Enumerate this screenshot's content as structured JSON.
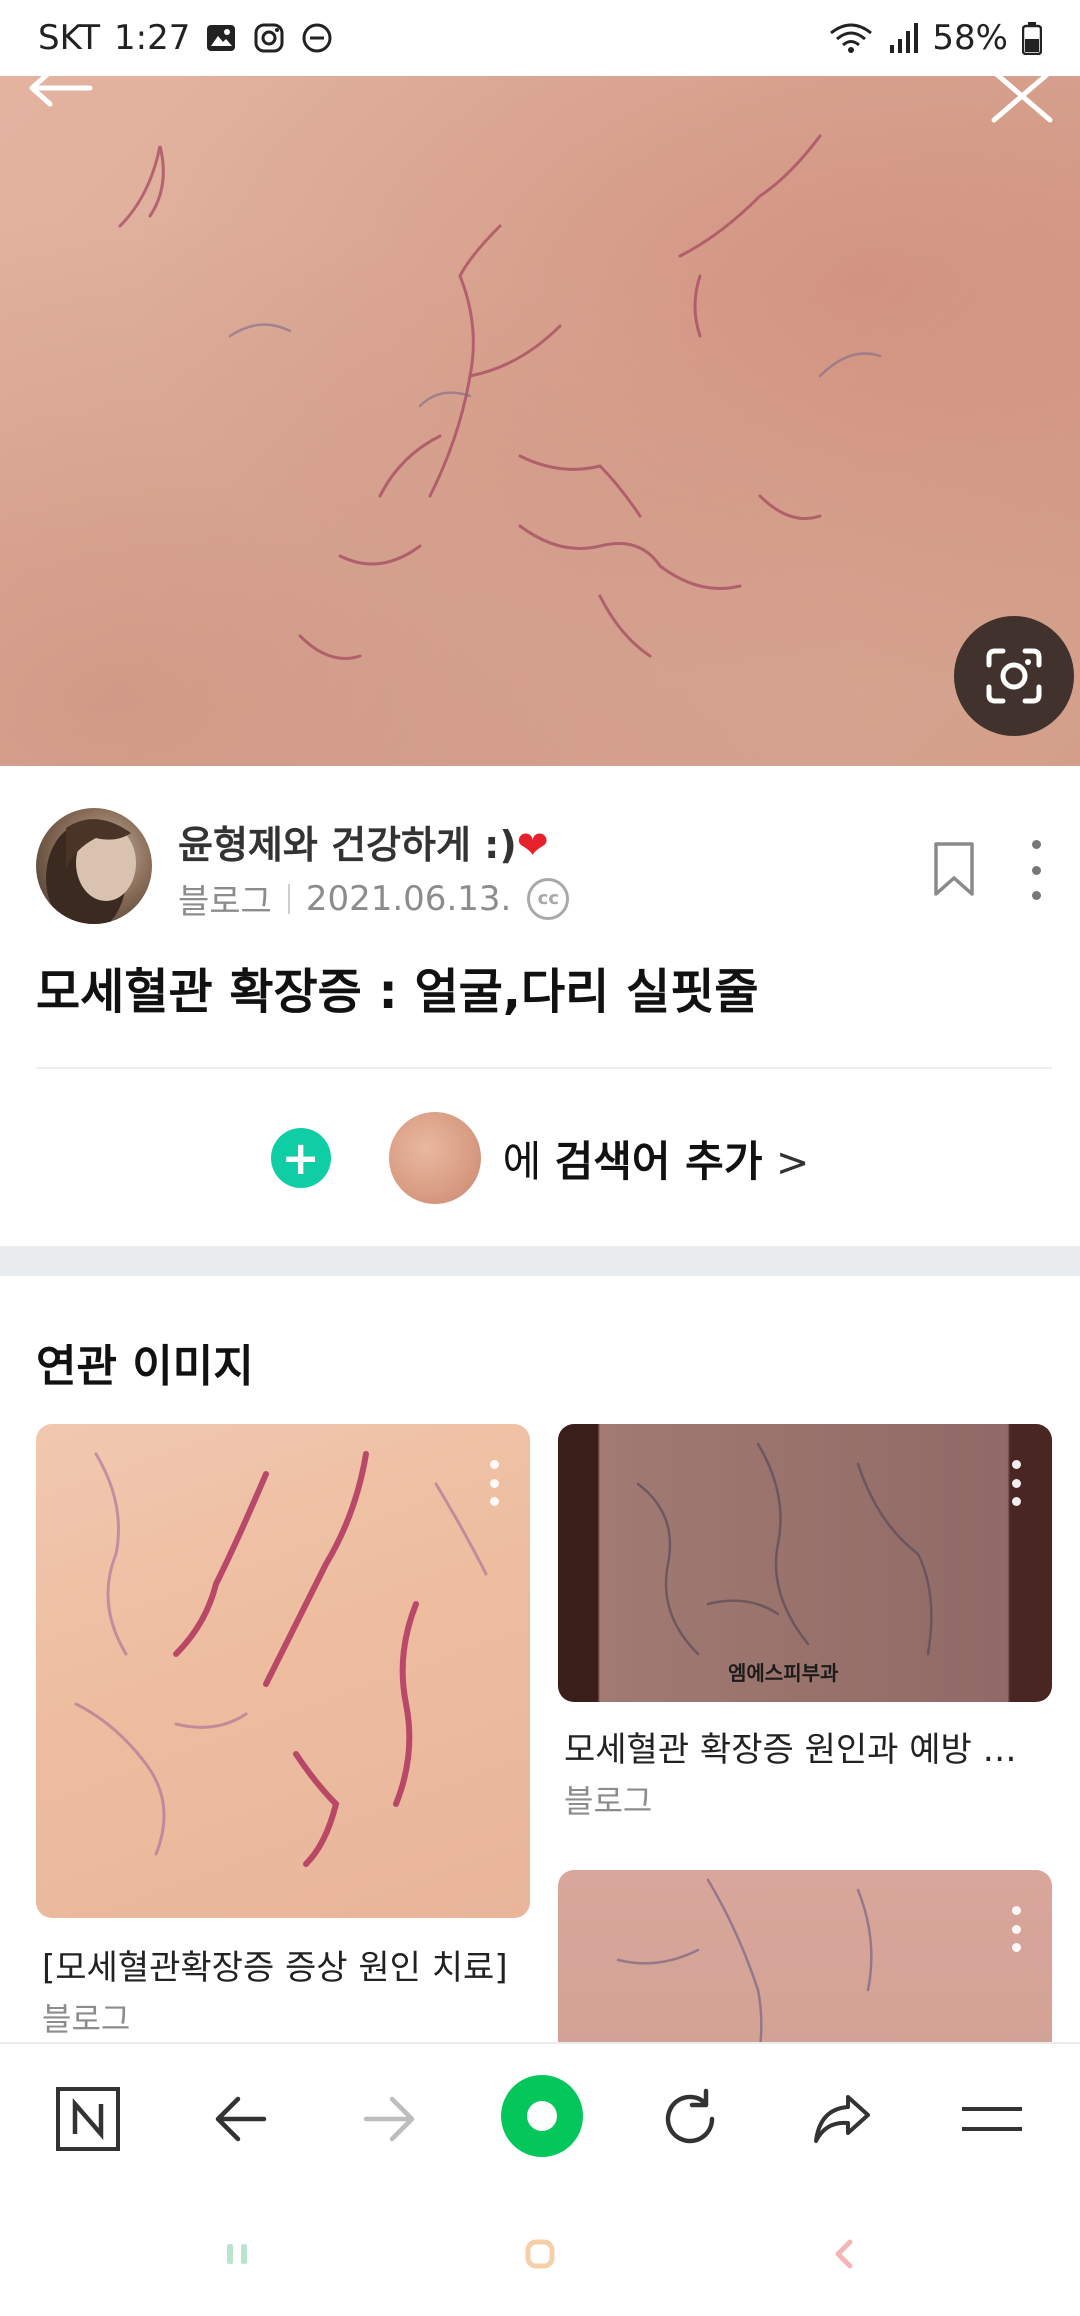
{
  "status_bar": {
    "carrier": "SKT",
    "time": "1:27",
    "battery": "58%"
  },
  "post": {
    "blog_name": "윤형제와 건강하게 :)",
    "heart": "❤",
    "source": "블로그",
    "date": "2021.06.13.",
    "license_badge": "cc",
    "title": "모세혈관 확장증 : 얼굴,다리 실핏줄"
  },
  "add_search": {
    "particle": "에",
    "action": "검색어 추가",
    "chevron": ">"
  },
  "related": {
    "section_title": "연관 이미지",
    "cards": [
      {
        "title": "[모세혈관확장증 증상 원인 치료]",
        "source": "블로그"
      },
      {
        "title": "모세혈관 확장증 원인과 예방 및 ...",
        "source": "블로그",
        "watermark": "엠에스피부과"
      }
    ]
  },
  "colors": {
    "accent_green": "#0fcda5",
    "toolbar_green": "#03c75a",
    "heart_red": "#e6212c"
  },
  "icons": {
    "toolbar": [
      "naver-home-icon",
      "back-arrow-icon",
      "forward-arrow-icon",
      "green-dot-icon",
      "refresh-icon",
      "share-icon",
      "menu-icon"
    ],
    "system_nav": [
      "recent-apps-icon",
      "home-icon",
      "back-icon"
    ]
  }
}
